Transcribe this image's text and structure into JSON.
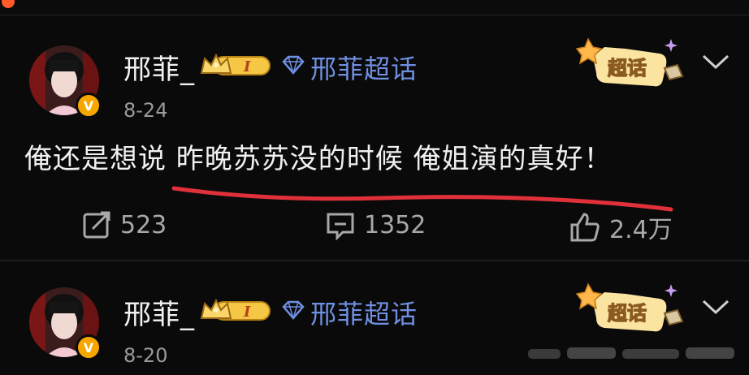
{
  "posts": [
    {
      "username": "邢菲_",
      "level": "I",
      "topic": "邢菲超话",
      "date": "8-24",
      "sticker": "超话",
      "content": "俺还是想说 昨晚苏苏没的时候 俺姐演的真好！",
      "actions": {
        "repost_count": "523",
        "comment_count": "1352",
        "like_count": "2.4万"
      }
    },
    {
      "username": "邢菲_",
      "level": "I",
      "topic": "邢菲超话",
      "date": "8-20",
      "sticker": "超话"
    }
  ],
  "icons": {
    "verified": "v-badge-icon",
    "crown": "crown-badge-icon",
    "diamond": "diamond-icon",
    "repost": "repost-icon",
    "comment": "comment-icon",
    "like": "thumbs-up-icon",
    "more": "chevron-down-icon"
  },
  "colors": {
    "background": "#0a0a0a",
    "topic": "#6f8fe0",
    "verified": "#f7a600",
    "annotation": "#e0313a",
    "text_secondary": "#9a9a9a"
  }
}
